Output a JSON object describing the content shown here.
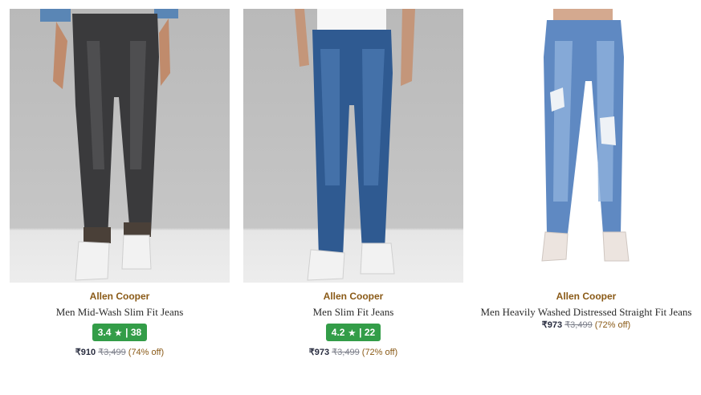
{
  "currency": "₹",
  "products": [
    {
      "brand": "Allen Cooper",
      "title": "Men Mid-Wash Slim Fit Jeans",
      "rating_score": "3.4",
      "rating_star": "★",
      "rating_sep": "|",
      "rating_count": "38",
      "price": "₹910",
      "mrp": "₹3,499",
      "discount": "(74% off)",
      "image_icon": "black-jeans-model-photo"
    },
    {
      "brand": "Allen Cooper",
      "title": "Men Slim Fit Jeans",
      "rating_score": "4.2",
      "rating_star": "★",
      "rating_sep": "|",
      "rating_count": "22",
      "price": "₹973",
      "mrp": "₹3,499",
      "discount": "(72% off)",
      "image_icon": "blue-jeans-model-photo"
    },
    {
      "brand": "Allen Cooper",
      "title": "Men Heavily Washed Distressed Straight Fit Jeans",
      "price": "₹973",
      "mrp": "₹3,499",
      "discount": "(72% off)",
      "image_icon": "distressed-jeans-model-photo"
    }
  ],
  "colors": {
    "brand": "#8a5a17",
    "rating_badge": "#339d48",
    "price": "#282c3f",
    "mrp": "#7e818c"
  }
}
